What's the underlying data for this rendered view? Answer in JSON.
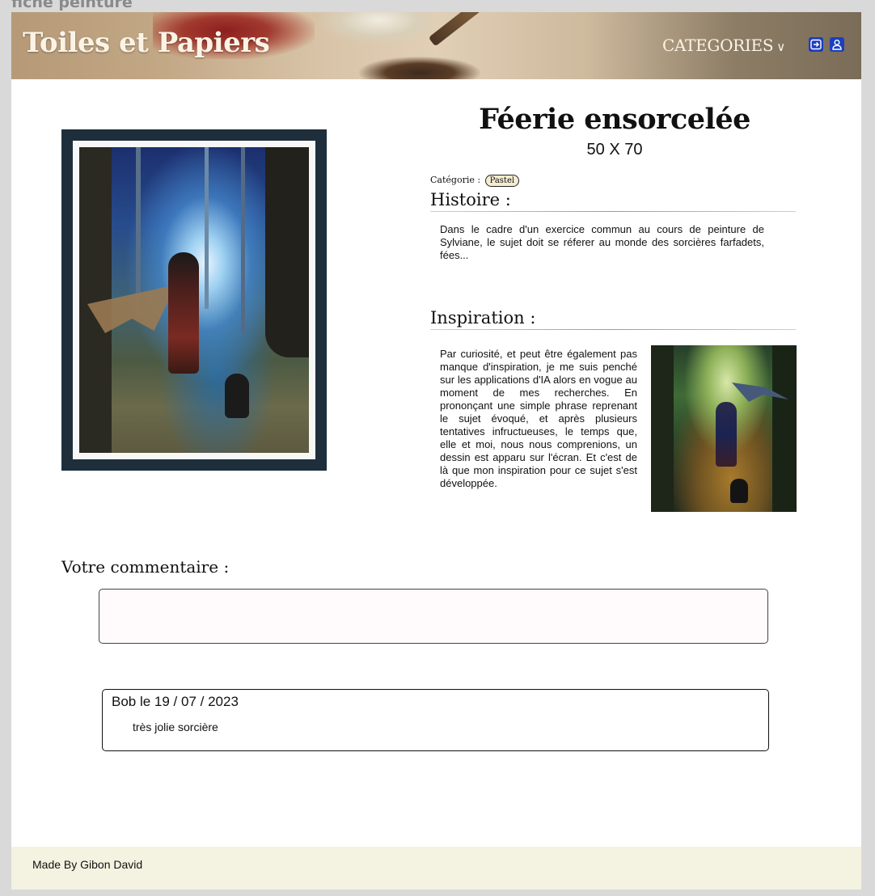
{
  "frame": {
    "label": "fiche peinture"
  },
  "header": {
    "brand": "Toiles et Papiers",
    "nav": {
      "categories_label": "CATEGORIES",
      "chevron": "∨"
    },
    "icons": [
      "logout-icon",
      "user-icon"
    ],
    "accent_color": "#1c3fbf"
  },
  "artwork": {
    "title": "Féerie ensorcelée",
    "dimensions": "50 X 70",
    "category_label": "Catégorie :",
    "category": "Pastel"
  },
  "history": {
    "heading": "Histoire :",
    "text": "Dans le cadre d'un exercice commun au cours de peinture de Sylviane, le sujet doit se réferer au monde des sorcières farfadets, fées..."
  },
  "inspiration": {
    "heading": "Inspiration :",
    "text": "Par curiosité, et peut être également pas manque d'inspiration, je me suis penché sur les applications d'IA alors en vogue au moment de mes recherches. En prononçant une simple phrase reprenant le sujet évoqué, et après plusieurs tentatives infructueuses, le temps que, elle et moi, nous nous comprenions, un dessin est apparu sur l'écran. Et c'est de là que mon inspiration pour ce sujet s'est développée."
  },
  "comments": {
    "heading": "Votre commentaire :",
    "input_value": "",
    "items": [
      {
        "author_line": "Bob le 19 / 07 / 2023",
        "text": "très jolie sorcière"
      }
    ]
  },
  "footer": {
    "text": "Made By Gibon David"
  }
}
